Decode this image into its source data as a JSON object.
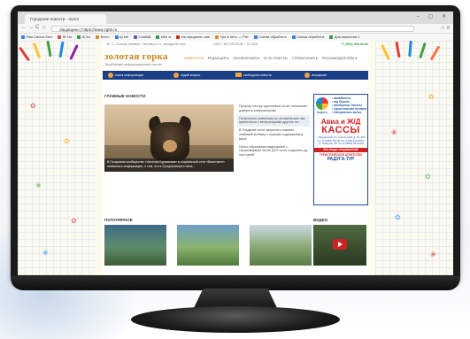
{
  "browser": {
    "tab_title": "Городские новости - Золот",
    "window_controls": "– ▢ ✕",
    "back": "←",
    "forward": "→",
    "reload": "C",
    "home": "⌂",
    "url": "Защищено | https://www.zgbk.ru",
    "addr_right": "☆ ≡",
    "bookmarks": [
      {
        "label": "Рам Сипин-Serv",
        "color": "#3b7dd8"
      },
      {
        "label": "Ж Ни",
        "color": "#e05050"
      },
      {
        "label": "Ж Ал",
        "color": "#2e9a40"
      },
      {
        "label": "Бесгт",
        "color": "#e08a1e"
      },
      {
        "label": "ф sbi",
        "color": "#3b7dd8"
      },
      {
        "label": "Совбай",
        "color": "#6b4fbb"
      },
      {
        "label": "e6ie w",
        "color": "#2e9a40"
      },
      {
        "label": "На оформле..ние",
        "color": "#d32020"
      },
      {
        "label": "Ура в него — Рит",
        "color": "#e08a1e"
      },
      {
        "label": "Схема обработ.и",
        "color": "#3b7dd8"
      },
      {
        "label": "Схема обработ.и",
        "color": "#3b7dd8"
      },
      {
        "label": "Для вакансии с",
        "color": "#2e9a40"
      }
    ]
  },
  "site": {
    "weather": "18 °C, Солнце облачно, 746 мм рт. ст., западный 4 м/с",
    "currency": "USD = 66.7053   EUR = 76.2329",
    "phone": "+7 (964) 000-00-00",
    "logo": "золотая горка",
    "tagline": "Вырбовский информационный портал",
    "nav": [
      "НОВОСТИ ▾",
      "РЕДАКЦИЯ ▾",
      "ОБЪЯВЛЕНИЯ ▾",
      "ЕСТЬ РАБОТА!",
      "СПРАВОЧНИК ▾",
      "РЕКЛАМОДАТЕЛЯМ ▾"
    ],
    "bluebar": [
      "поиск информации",
      "задай вопрос",
      "свободная новость",
      "актуарная"
    ],
    "main_news_title": "ГЛАВНЫЕ НОВОСТИ",
    "hero_caption": "В Гусарском сообществе «Честная Бурханова» в социальной сети «Вконтакте» появилась информация, о том, что в Гусарсковского села...",
    "news_items": [
      "Пророку сестру однозначно хотят полностью доверить компьютеризм",
      "Получитель животным по человеческие как приютиться с ветеринарами другого на...",
      "В Гладкове хотят запретить назывть любимой колбасу с нужным содержанием мяса",
      "Пресс обращения видеозапей к страховщикам после ДТП хотят сократить до пяти дней"
    ],
    "popular_title": "ПОПУЛЯРНОЕ",
    "video_title": "ВИДЕО",
    "ad": {
      "logo_name": "РАДУГА",
      "list": [
        "• авиабилеты",
        "• ж/д билеты",
        "• автобусные билеты",
        "• туристические путевки",
        "• театральные кассы"
      ],
      "title1": "Авиа и Ж/Д",
      "title2": "КАССЫ",
      "address": "г. Бердянский, ул. Строителей, д. 10, 254 тел. 8 (3952) 567-89-01, 8-904-123-4567, ул. Гагарина, 38 тел. 8 (3952) 56-44-00",
      "strip": "Без виды отправлений",
      "tour_label": "ТУРИСТИЧЕСКОЕ АГЕНТСТВО",
      "tour_name": "РАДУГА-ТУР"
    }
  },
  "colors": {
    "accent": "#c8841c",
    "nav_bar": "#1a3e86",
    "phone": "#2e9a40",
    "ad_red": "#d32020",
    "ad_blue": "#1b4fa0"
  }
}
